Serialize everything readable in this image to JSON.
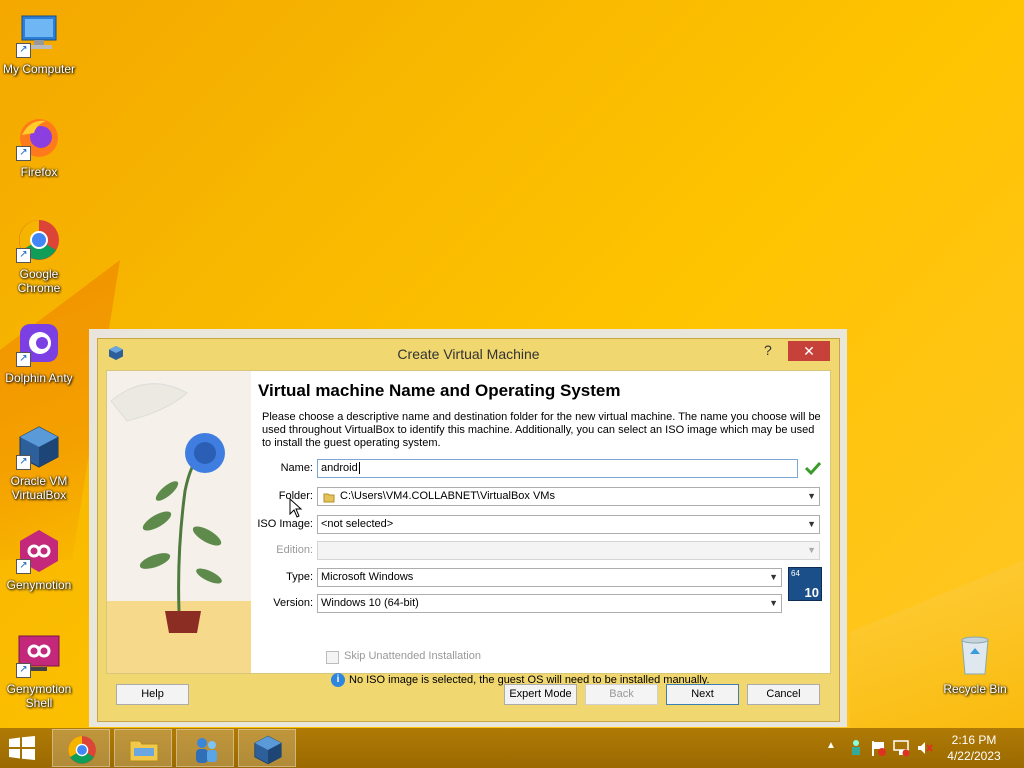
{
  "desktop": {
    "icons": [
      {
        "label": "My Computer"
      },
      {
        "label": "Firefox"
      },
      {
        "label": "Google Chrome"
      },
      {
        "label": "Dolphin Anty"
      },
      {
        "label": "Oracle VM VirtualBox"
      },
      {
        "label": "Genymotion"
      },
      {
        "label": "Genymotion Shell"
      },
      {
        "label": "Recycle Bin"
      }
    ]
  },
  "dialog": {
    "title": "Create Virtual Machine",
    "help_glyph": "?",
    "close_glyph": "✕",
    "heading": "Virtual machine Name and Operating System",
    "description": "Please choose a descriptive name and destination folder for the new virtual machine. The name you choose will be used throughout VirtualBox to identify this machine. Additionally, you can select an ISO image which may be used to install the guest operating system.",
    "fields": {
      "name": {
        "label": "Name:",
        "value": "android"
      },
      "folder": {
        "label": "Folder:",
        "value": "C:\\Users\\VM4.COLLABNET\\VirtualBox VMs"
      },
      "iso": {
        "label": "ISO Image:",
        "value": "<not selected>"
      },
      "edition": {
        "label": "Edition:",
        "value": ""
      },
      "type": {
        "label": "Type:",
        "value": "Microsoft Windows"
      },
      "version": {
        "label": "Version:",
        "value": "Windows 10 (64-bit)"
      }
    },
    "os_badge": {
      "top": "64",
      "bottom": "10"
    },
    "skip_unattended": {
      "label": "Skip Unattended Installation",
      "checked": false
    },
    "info": "No ISO image is selected, the guest OS will need to be installed manually.",
    "buttons": {
      "help": "Help",
      "expert": "Expert Mode",
      "back": "Back",
      "next": "Next",
      "cancel": "Cancel"
    }
  },
  "taskbar": {
    "apps": [
      "chrome",
      "file-explorer",
      "people-app",
      "virtualbox"
    ],
    "time": "2:16 PM",
    "date": "4/22/2023"
  },
  "colors": {
    "accent": "#ffc400",
    "close": "#c7413b",
    "dialog_frame": "#f0d770"
  }
}
